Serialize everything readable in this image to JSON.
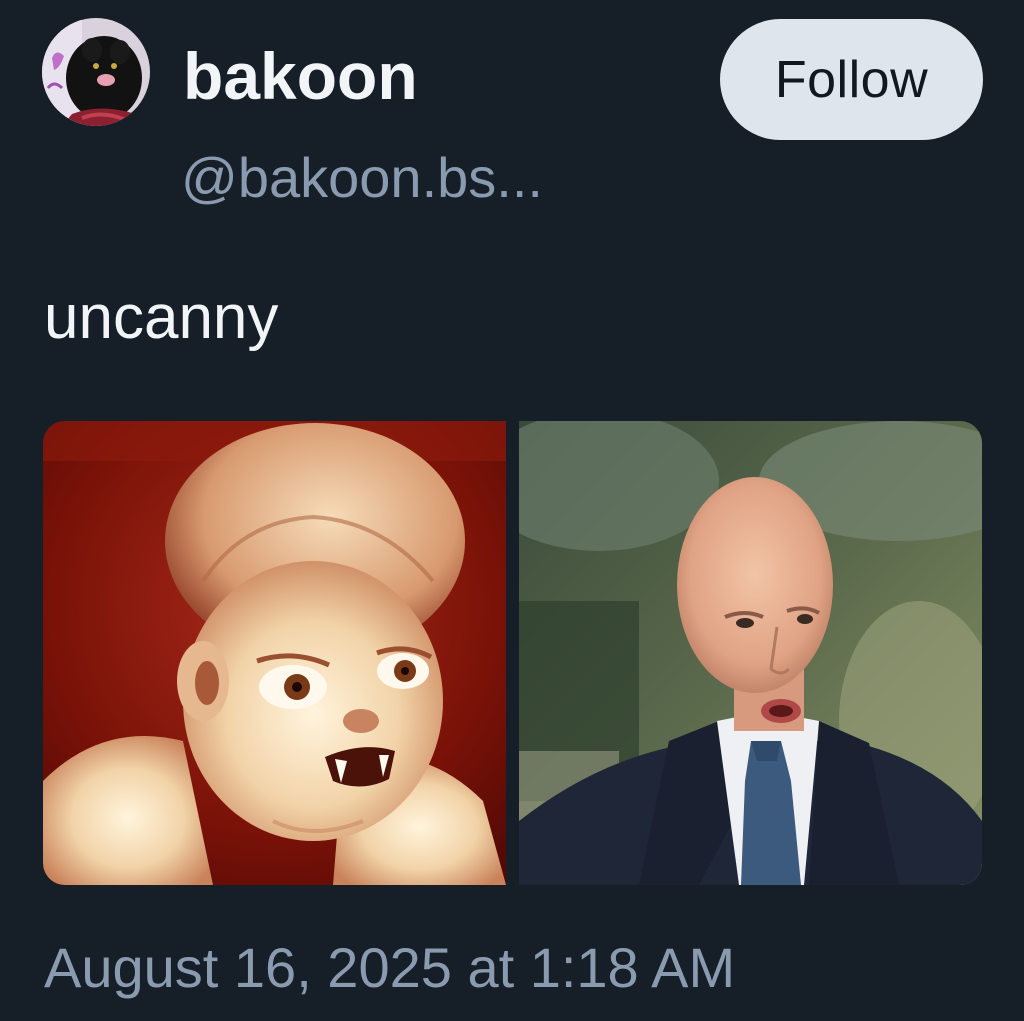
{
  "post": {
    "author": {
      "display_name": "bakoon",
      "handle": "@bakoon.bs..."
    },
    "follow_label": "Follow",
    "text": "uncanny",
    "timestamp": "August 16, 2025 at 1:18 AM",
    "media": [
      {
        "description": "creature-photo"
      },
      {
        "description": "man-in-suit-photo"
      }
    ]
  },
  "colors": {
    "background": "#161e27",
    "text_primary": "#f2f5f8",
    "text_secondary": "#8a9bb0",
    "follow_button_bg": "#dfe5ec"
  }
}
